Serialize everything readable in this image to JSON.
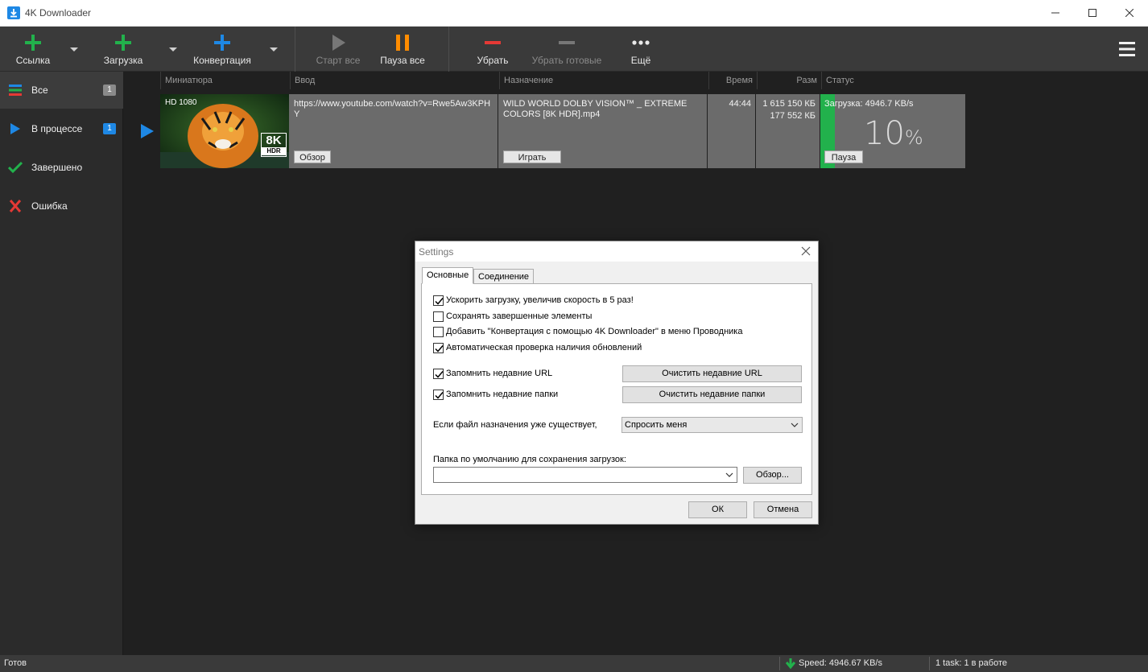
{
  "window": {
    "title": "4K Downloader"
  },
  "toolbar": {
    "link_label": "Ссылка",
    "download_label": "Загрузка",
    "convert_label": "Конвертация",
    "start_all_label": "Старт все",
    "pause_all_label": "Пауза все",
    "remove_label": "Убрать",
    "remove_done_label": "Убрать готовые",
    "more_label": "Ещё"
  },
  "sidebar": {
    "items": [
      {
        "label": "Все",
        "count": "1"
      },
      {
        "label": "В процессе",
        "count": "1"
      },
      {
        "label": "Завершено"
      },
      {
        "label": "Ошибка"
      }
    ]
  },
  "columns": {
    "thumbnail": "Миниатюра",
    "input": "Ввод",
    "destination": "Назначение",
    "time": "Время",
    "size": "Разм",
    "status": "Статус"
  },
  "download": {
    "quality": "HD 1080",
    "url": "https://www.youtube.com/watch?v=Rwe5Aw3KPHY",
    "browse_label": "Обзор",
    "filename": "WILD WORLD DOLBY VISION™ _ EXTREME COLORS [8K HDR].mp4",
    "play_label": "Играть",
    "duration": "44:44",
    "size_total": "1 615 150 КБ",
    "size_done": "177 552 КБ",
    "status_text": "Загрузка: 4946.7 KB/s",
    "progress_percent": 10,
    "progress_label": "10",
    "percent_sign": "%",
    "pause_label": "Пауза",
    "badge_8k": "8K",
    "badge_hdr": "HDR"
  },
  "statusbar": {
    "ready": "Готов",
    "speed": "Speed: 4946.67 KB/s",
    "tasks": "1 task: 1 в работе"
  },
  "settings": {
    "title": "Settings",
    "tab_general": "Основные",
    "tab_connection": "Соединение",
    "opt_speedup": "Ускорить загрузку, увеличив скорость в 5 раз!",
    "opt_speedup_checked": true,
    "opt_keep_completed": "Сохранять завершенные элементы",
    "opt_keep_completed_checked": false,
    "opt_explorer_menu": "Добавить \"Конвертация с помощью 4K Downloader\" в меню Проводника",
    "opt_explorer_menu_checked": false,
    "opt_auto_update": "Автоматическая проверка наличия обновлений",
    "opt_auto_update_checked": true,
    "opt_remember_urls": "Запомнить недавние URL",
    "opt_remember_urls_checked": true,
    "clear_urls_label": "Очистить недавние URL",
    "opt_remember_folders": "Запомнить недавние папки",
    "opt_remember_folders_checked": true,
    "clear_folders_label": "Очистить недавние папки",
    "file_exists_label": "Если файл назначения уже существует,",
    "file_exists_value": "Спросить меня",
    "default_folder_label": "Папка по умолчанию для сохранения загрузок:",
    "default_folder_value": "",
    "browse_label": "Обзор...",
    "ok_label": "ОК",
    "cancel_label": "Отмена"
  },
  "colors": {
    "accent_green": "#22b14c",
    "accent_blue": "#1e88e5",
    "accent_red": "#e53935",
    "accent_orange": "#ff8c00"
  }
}
